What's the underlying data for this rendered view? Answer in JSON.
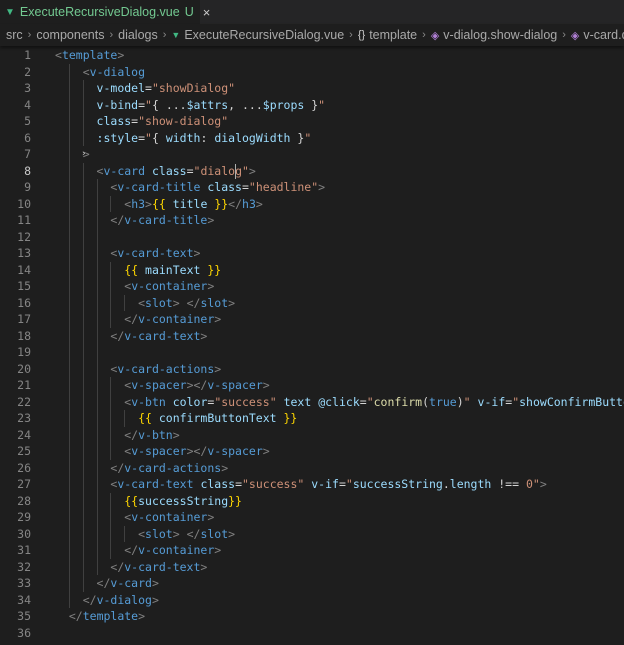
{
  "tab": {
    "icon": "vue-icon",
    "title": "ExecuteRecursiveDialog.vue",
    "badge": "U",
    "close": "×"
  },
  "breadcrumb": [
    "src",
    "components",
    "dialogs",
    "ExecuteRecursiveDialog.vue",
    "template",
    "v-dialog.show-dialog",
    "v-card.dialog"
  ],
  "editor": {
    "active_line": 8,
    "lines": [
      {
        "n": "1",
        "tokens": [
          [
            "<",
            "p"
          ],
          [
            "template",
            "t"
          ],
          [
            ">",
            "p"
          ]
        ]
      },
      {
        "n": "2",
        "tokens": [
          [
            "    ",
            "w"
          ],
          [
            "<",
            "p"
          ],
          [
            "v-dialog",
            "t"
          ]
        ]
      },
      {
        "n": "3",
        "tokens": [
          [
            "      ",
            "w"
          ],
          [
            "v-model",
            "a"
          ],
          [
            "=",
            "w"
          ],
          [
            "\"showDialog\"",
            "s"
          ]
        ]
      },
      {
        "n": "4",
        "tokens": [
          [
            "      ",
            "w"
          ],
          [
            "v-bind",
            "a"
          ],
          [
            "=",
            "w"
          ],
          [
            "\"",
            "s"
          ],
          [
            "{ ...",
            "w"
          ],
          [
            "$attrs",
            "a"
          ],
          [
            ", ...",
            "w"
          ],
          [
            "$props",
            "a"
          ],
          [
            " }",
            "w"
          ],
          [
            "\"",
            "s"
          ]
        ]
      },
      {
        "n": "5",
        "tokens": [
          [
            "      ",
            "w"
          ],
          [
            "class",
            "a"
          ],
          [
            "=",
            "w"
          ],
          [
            "\"show-dialog\"",
            "s"
          ]
        ]
      },
      {
        "n": "6",
        "tokens": [
          [
            "      ",
            "w"
          ],
          [
            ":style",
            "a"
          ],
          [
            "=",
            "w"
          ],
          [
            "\"",
            "s"
          ],
          [
            "{ ",
            "w"
          ],
          [
            "width",
            "a"
          ],
          [
            ": ",
            "w"
          ],
          [
            "dialogWidth",
            "a"
          ],
          [
            " }",
            "w"
          ],
          [
            "\"",
            "s"
          ]
        ]
      },
      {
        "n": "7",
        "tokens": [
          [
            "    ",
            "w"
          ],
          [
            ">",
            "p"
          ]
        ]
      },
      {
        "n": "8",
        "tokens": [
          [
            "      ",
            "w"
          ],
          [
            "<",
            "p"
          ],
          [
            "v-card",
            "t"
          ],
          [
            " ",
            "w"
          ],
          [
            "class",
            "a"
          ],
          [
            "=",
            "w"
          ],
          [
            "\"dialog\"",
            "s"
          ],
          [
            ">",
            "p"
          ]
        ]
      },
      {
        "n": "9",
        "tokens": [
          [
            "        ",
            "w"
          ],
          [
            "<",
            "p"
          ],
          [
            "v-card-title",
            "t"
          ],
          [
            " ",
            "w"
          ],
          [
            "class",
            "a"
          ],
          [
            "=",
            "w"
          ],
          [
            "\"headline\"",
            "s"
          ],
          [
            ">",
            "p"
          ]
        ]
      },
      {
        "n": "10",
        "tokens": [
          [
            "          ",
            "w"
          ],
          [
            "<",
            "p"
          ],
          [
            "h3",
            "t"
          ],
          [
            ">",
            "p"
          ],
          [
            "{{ ",
            "y"
          ],
          [
            "title",
            "a"
          ],
          [
            " }}",
            "y"
          ],
          [
            "</",
            "p"
          ],
          [
            "h3",
            "t"
          ],
          [
            ">",
            "p"
          ]
        ]
      },
      {
        "n": "11",
        "tokens": [
          [
            "        ",
            "w"
          ],
          [
            "</",
            "p"
          ],
          [
            "v-card-title",
            "t"
          ],
          [
            ">",
            "p"
          ]
        ]
      },
      {
        "n": "12",
        "tokens": []
      },
      {
        "n": "13",
        "tokens": [
          [
            "        ",
            "w"
          ],
          [
            "<",
            "p"
          ],
          [
            "v-card-text",
            "t"
          ],
          [
            ">",
            "p"
          ]
        ]
      },
      {
        "n": "14",
        "tokens": [
          [
            "          ",
            "w"
          ],
          [
            "{{ ",
            "y"
          ],
          [
            "mainText",
            "a"
          ],
          [
            " }}",
            "y"
          ]
        ]
      },
      {
        "n": "15",
        "tokens": [
          [
            "          ",
            "w"
          ],
          [
            "<",
            "p"
          ],
          [
            "v-container",
            "t"
          ],
          [
            ">",
            "p"
          ]
        ]
      },
      {
        "n": "16",
        "tokens": [
          [
            "            ",
            "w"
          ],
          [
            "<",
            "p"
          ],
          [
            "slot",
            "t"
          ],
          [
            "> ",
            "p"
          ],
          [
            "</",
            "p"
          ],
          [
            "slot",
            "t"
          ],
          [
            ">",
            "p"
          ]
        ]
      },
      {
        "n": "17",
        "tokens": [
          [
            "          ",
            "w"
          ],
          [
            "</",
            "p"
          ],
          [
            "v-container",
            "t"
          ],
          [
            ">",
            "p"
          ]
        ]
      },
      {
        "n": "18",
        "tokens": [
          [
            "        ",
            "w"
          ],
          [
            "</",
            "p"
          ],
          [
            "v-card-text",
            "t"
          ],
          [
            ">",
            "p"
          ]
        ]
      },
      {
        "n": "19",
        "tokens": []
      },
      {
        "n": "20",
        "tokens": [
          [
            "        ",
            "w"
          ],
          [
            "<",
            "p"
          ],
          [
            "v-card-actions",
            "t"
          ],
          [
            ">",
            "p"
          ]
        ]
      },
      {
        "n": "21",
        "tokens": [
          [
            "          ",
            "w"
          ],
          [
            "<",
            "p"
          ],
          [
            "v-spacer",
            "t"
          ],
          [
            "></",
            "p"
          ],
          [
            "v-spacer",
            "t"
          ],
          [
            ">",
            "p"
          ]
        ]
      },
      {
        "n": "22",
        "tokens": [
          [
            "          ",
            "w"
          ],
          [
            "<",
            "p"
          ],
          [
            "v-btn",
            "t"
          ],
          [
            " ",
            "w"
          ],
          [
            "color",
            "a"
          ],
          [
            "=",
            "w"
          ],
          [
            "\"success\"",
            "s"
          ],
          [
            " ",
            "w"
          ],
          [
            "text",
            "a"
          ],
          [
            " ",
            "w"
          ],
          [
            "@click",
            "a"
          ],
          [
            "=",
            "w"
          ],
          [
            "\"",
            "s"
          ],
          [
            "confirm",
            "f"
          ],
          [
            "(",
            "w"
          ],
          [
            "true",
            "k"
          ],
          [
            ")",
            "w"
          ],
          [
            "\"",
            "s"
          ],
          [
            " ",
            "w"
          ],
          [
            "v-if",
            "a"
          ],
          [
            "=",
            "w"
          ],
          [
            "\"",
            "s"
          ],
          [
            "showConfirmButton",
            "a"
          ],
          [
            "\"",
            "s"
          ]
        ]
      },
      {
        "n": "23",
        "tokens": [
          [
            "            ",
            "w"
          ],
          [
            "{{ ",
            "y"
          ],
          [
            "confirmButtonText",
            "a"
          ],
          [
            " }}",
            "y"
          ]
        ]
      },
      {
        "n": "24",
        "tokens": [
          [
            "          ",
            "w"
          ],
          [
            "</",
            "p"
          ],
          [
            "v-btn",
            "t"
          ],
          [
            ">",
            "p"
          ]
        ]
      },
      {
        "n": "25",
        "tokens": [
          [
            "          ",
            "w"
          ],
          [
            "<",
            "p"
          ],
          [
            "v-spacer",
            "t"
          ],
          [
            "></",
            "p"
          ],
          [
            "v-spacer",
            "t"
          ],
          [
            ">",
            "p"
          ]
        ]
      },
      {
        "n": "26",
        "tokens": [
          [
            "        ",
            "w"
          ],
          [
            "</",
            "p"
          ],
          [
            "v-card-actions",
            "t"
          ],
          [
            ">",
            "p"
          ]
        ]
      },
      {
        "n": "27",
        "tokens": [
          [
            "        ",
            "w"
          ],
          [
            "<",
            "p"
          ],
          [
            "v-card-text",
            "t"
          ],
          [
            " ",
            "w"
          ],
          [
            "class",
            "a"
          ],
          [
            "=",
            "w"
          ],
          [
            "\"success\"",
            "s"
          ],
          [
            " ",
            "w"
          ],
          [
            "v-if",
            "a"
          ],
          [
            "=",
            "w"
          ],
          [
            "\"",
            "s"
          ],
          [
            "successString",
            "a"
          ],
          [
            ".",
            "w"
          ],
          [
            "length",
            "a"
          ],
          [
            " !== ",
            "w"
          ],
          [
            "0",
            "s"
          ],
          [
            "\"",
            "s"
          ],
          [
            ">",
            "p"
          ]
        ]
      },
      {
        "n": "28",
        "tokens": [
          [
            "          ",
            "w"
          ],
          [
            "{{",
            "y"
          ],
          [
            "successString",
            "a"
          ],
          [
            "}}",
            "y"
          ]
        ]
      },
      {
        "n": "29",
        "tokens": [
          [
            "          ",
            "w"
          ],
          [
            "<",
            "p"
          ],
          [
            "v-container",
            "t"
          ],
          [
            ">",
            "p"
          ]
        ]
      },
      {
        "n": "30",
        "tokens": [
          [
            "            ",
            "w"
          ],
          [
            "<",
            "p"
          ],
          [
            "slot",
            "t"
          ],
          [
            "> ",
            "p"
          ],
          [
            "</",
            "p"
          ],
          [
            "slot",
            "t"
          ],
          [
            ">",
            "p"
          ]
        ]
      },
      {
        "n": "31",
        "tokens": [
          [
            "          ",
            "w"
          ],
          [
            "</",
            "p"
          ],
          [
            "v-container",
            "t"
          ],
          [
            ">",
            "p"
          ]
        ]
      },
      {
        "n": "32",
        "tokens": [
          [
            "        ",
            "w"
          ],
          [
            "</",
            "p"
          ],
          [
            "v-card-text",
            "t"
          ],
          [
            ">",
            "p"
          ]
        ]
      },
      {
        "n": "33",
        "tokens": [
          [
            "      ",
            "w"
          ],
          [
            "</",
            "p"
          ],
          [
            "v-card",
            "t"
          ],
          [
            ">",
            "p"
          ]
        ]
      },
      {
        "n": "34",
        "tokens": [
          [
            "    ",
            "w"
          ],
          [
            "</",
            "p"
          ],
          [
            "v-dialog",
            "t"
          ],
          [
            ">",
            "p"
          ]
        ]
      },
      {
        "n": "35",
        "tokens": [
          [
            "  ",
            "w"
          ],
          [
            "</",
            "p"
          ],
          [
            "template",
            "t"
          ],
          [
            ">",
            "p"
          ]
        ]
      },
      {
        "n": "36",
        "tokens": []
      }
    ]
  }
}
